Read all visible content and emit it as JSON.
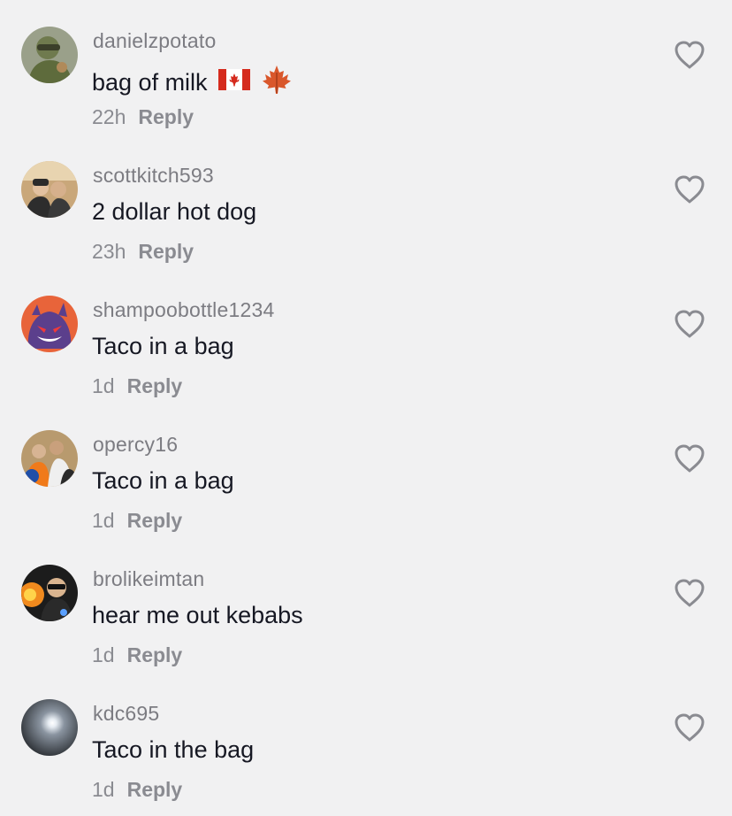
{
  "comments": [
    {
      "username": "danielzpotato",
      "text": "bag of milk",
      "time": "22h",
      "reply_label": "Reply",
      "emojis": [
        "canada-flag",
        "maple-leaf"
      ]
    },
    {
      "username": "scottkitch593",
      "text": "2 dollar hot dog",
      "time": "23h",
      "reply_label": "Reply"
    },
    {
      "username": "shampoobottle1234",
      "text": "Taco in a bag",
      "time": "1d",
      "reply_label": "Reply"
    },
    {
      "username": "opercy16",
      "text": "Taco in a bag",
      "time": "1d",
      "reply_label": "Reply"
    },
    {
      "username": "brolikeimtan",
      "text": "hear me out kebabs",
      "time": "1d",
      "reply_label": "Reply"
    },
    {
      "username": "kdc695",
      "text": "Taco in the bag",
      "time": "1d",
      "reply_label": "Reply"
    }
  ],
  "colors": {
    "background": "#f1f1f2",
    "username": "#7c7c82",
    "text": "#161823",
    "meta": "#8a8b91",
    "heart_stroke": "#8a8b91"
  }
}
